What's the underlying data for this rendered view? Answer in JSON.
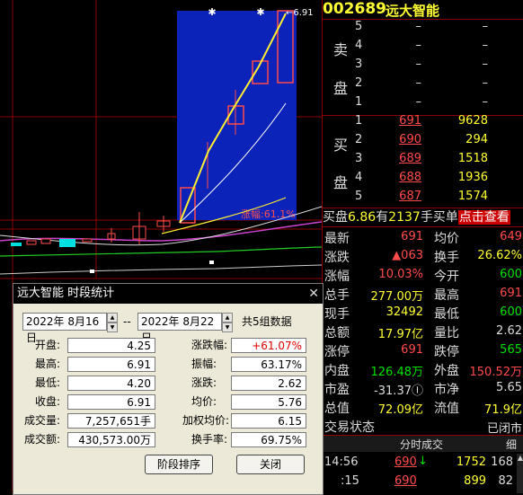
{
  "chart": {
    "high_marker": "6.91",
    "range_label": "涨幅:61.1%"
  },
  "stock": {
    "code": "002689",
    "name": "远大智能"
  },
  "orderbook": {
    "sell_label": [
      "卖",
      "盘"
    ],
    "buy_label": [
      "买",
      "盘"
    ],
    "asks": [
      {
        "level": "5",
        "price": "–",
        "volume": "–"
      },
      {
        "level": "4",
        "price": "–",
        "volume": "–"
      },
      {
        "level": "3",
        "price": "–",
        "volume": "–"
      },
      {
        "level": "2",
        "price": "–",
        "volume": "–"
      },
      {
        "level": "1",
        "price": "–",
        "volume": "–"
      }
    ],
    "bids": [
      {
        "level": "1",
        "price": "691",
        "volume": "9628"
      },
      {
        "level": "2",
        "price": "690",
        "volume": "294"
      },
      {
        "level": "3",
        "price": "689",
        "volume": "1518"
      },
      {
        "level": "4",
        "price": "688",
        "volume": "1936"
      },
      {
        "level": "5",
        "price": "687",
        "volume": "1574"
      }
    ]
  },
  "buy_bar": {
    "label_pre": "买盘",
    "ratio": "6.86",
    "mid": "有",
    "count": "2137",
    "post": "手买单",
    "link": "点击查看"
  },
  "stats": [
    {
      "l1": "最新",
      "v1": "691",
      "c1": "red",
      "l2": "均价",
      "v2": "649",
      "c2": "red"
    },
    {
      "l1": "涨跌",
      "v1": "▲063",
      "c1": "red",
      "l2": "换手",
      "v2": "26.62%",
      "c2": "yel"
    },
    {
      "l1": "涨幅",
      "v1": "10.03%",
      "c1": "red",
      "l2": "今开",
      "v2": "600",
      "c2": "grn"
    },
    {
      "l1": "总手",
      "v1": "277.00万",
      "c1": "yel",
      "l2": "最高",
      "v2": "691",
      "c2": "red"
    },
    {
      "l1": "现手",
      "v1": "32492",
      "c1": "yel",
      "l2": "最低",
      "v2": "600",
      "c2": "grn"
    },
    {
      "l1": "总额",
      "v1": "17.97亿",
      "c1": "yel",
      "l2": "量比",
      "v2": "2.62",
      "c2": "wht"
    },
    {
      "l1": "涨停",
      "v1": "691",
      "c1": "red",
      "l2": "跌停",
      "v2": "565",
      "c2": "grn"
    },
    {
      "l1": "内盘",
      "v1": "126.48万",
      "c1": "grn",
      "l2": "外盘",
      "v2": "150.52万",
      "c2": "red"
    },
    {
      "l1": "市盈",
      "v1": "-31.37Ⓘ",
      "c1": "wht",
      "l2": "市净",
      "v2": "5.65",
      "c2": "wht"
    },
    {
      "l1": "总值",
      "v1": "72.09亿",
      "c1": "yel",
      "l2": "流值",
      "v2": "71.9亿",
      "c2": "yel"
    },
    {
      "l1": "交易状态",
      "v1": "",
      "c1": "wht",
      "l2": "",
      "v2": "已闭市",
      "c2": "wht"
    }
  ],
  "ticks": {
    "header": "分时成交",
    "header_right": "细",
    "rows": [
      {
        "time": "14:56",
        "price": "690",
        "dir": "↓",
        "vol": "1752",
        "n": "168"
      },
      {
        "time": ":15",
        "price": "690",
        "dir": "",
        "vol": "899",
        "n": "82"
      }
    ]
  },
  "dialog": {
    "title": "远大智能 时段统计",
    "date_from": "2022年  8月16日",
    "date_to": "2022年  8月22日",
    "sep": "--",
    "count": "共5组数据",
    "left": [
      {
        "label": "开盘:",
        "value": "4.25"
      },
      {
        "label": "最高:",
        "value": "6.91"
      },
      {
        "label": "最低:",
        "value": "4.20"
      },
      {
        "label": "收盘:",
        "value": "6.91"
      },
      {
        "label": "成交量:",
        "value": "7,257,651手"
      },
      {
        "label": "成交额:",
        "value": "430,573.00万"
      }
    ],
    "right": [
      {
        "label": "涨跌幅:",
        "value": "+61.07%",
        "red": true
      },
      {
        "label": "振幅:",
        "value": "63.17%"
      },
      {
        "label": "涨跌:",
        "value": "2.62"
      },
      {
        "label": "均价:",
        "value": "5.76"
      },
      {
        "label": "加权均价:",
        "value": "6.15"
      },
      {
        "label": "换手率:",
        "value": "69.75%"
      }
    ],
    "btn_sort": "阶段排序",
    "btn_close": "关闭"
  },
  "colors": {
    "up": "#ff4b4b",
    "down": "#00e000",
    "accent": "#ffff33",
    "select": "#0b23b8"
  }
}
